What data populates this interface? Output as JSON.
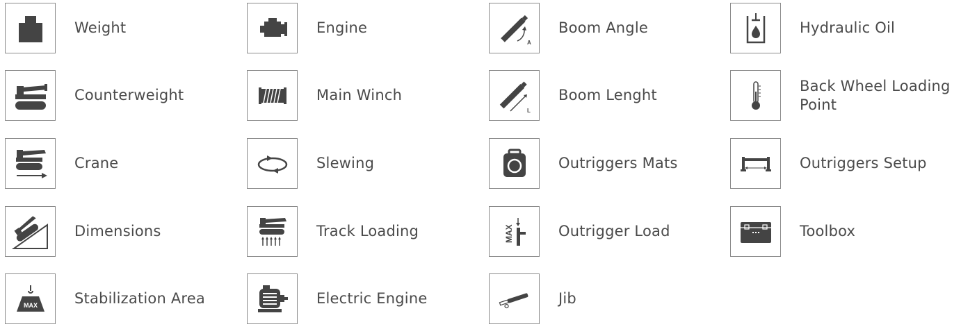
{
  "colors": {
    "icon": "#444444",
    "border": "#8a8a8a",
    "text": "#4a4a4a"
  },
  "items": [
    {
      "label": "Weight",
      "icon": "weight-icon"
    },
    {
      "label": "Counterweight",
      "icon": "counterweight-icon"
    },
    {
      "label": "Crane",
      "icon": "crane-icon"
    },
    {
      "label": "Dimensions",
      "icon": "dimensions-icon"
    },
    {
      "label": "Stabilization Area",
      "icon": "stabilization-area-icon"
    },
    {
      "label": "Engine",
      "icon": "engine-icon"
    },
    {
      "label": "Main Winch",
      "icon": "main-winch-icon"
    },
    {
      "label": "Slewing",
      "icon": "slewing-icon"
    },
    {
      "label": "Track Loading",
      "icon": "track-loading-icon"
    },
    {
      "label": "Electric Engine",
      "icon": "electric-engine-icon"
    },
    {
      "label": "Boom Angle",
      "icon": "boom-angle-icon",
      "badge": "A"
    },
    {
      "label": "Boom Lenght",
      "icon": "boom-length-icon",
      "badge": "L"
    },
    {
      "label": "Outriggers Mats",
      "icon": "outriggers-mats-icon"
    },
    {
      "label": "Outrigger Load",
      "icon": "outrigger-load-icon",
      "badge": "MAX"
    },
    {
      "label": "Jib",
      "icon": "jib-icon"
    },
    {
      "label": "Hydraulic Oil",
      "icon": "hydraulic-oil-icon"
    },
    {
      "label": "Back Wheel Loading\nPoint",
      "icon": "thermometer-icon"
    },
    {
      "label": "Outriggers Setup",
      "icon": "outriggers-setup-icon"
    },
    {
      "label": "Toolbox",
      "icon": "toolbox-icon"
    }
  ],
  "stabilization_badge": "MAX"
}
